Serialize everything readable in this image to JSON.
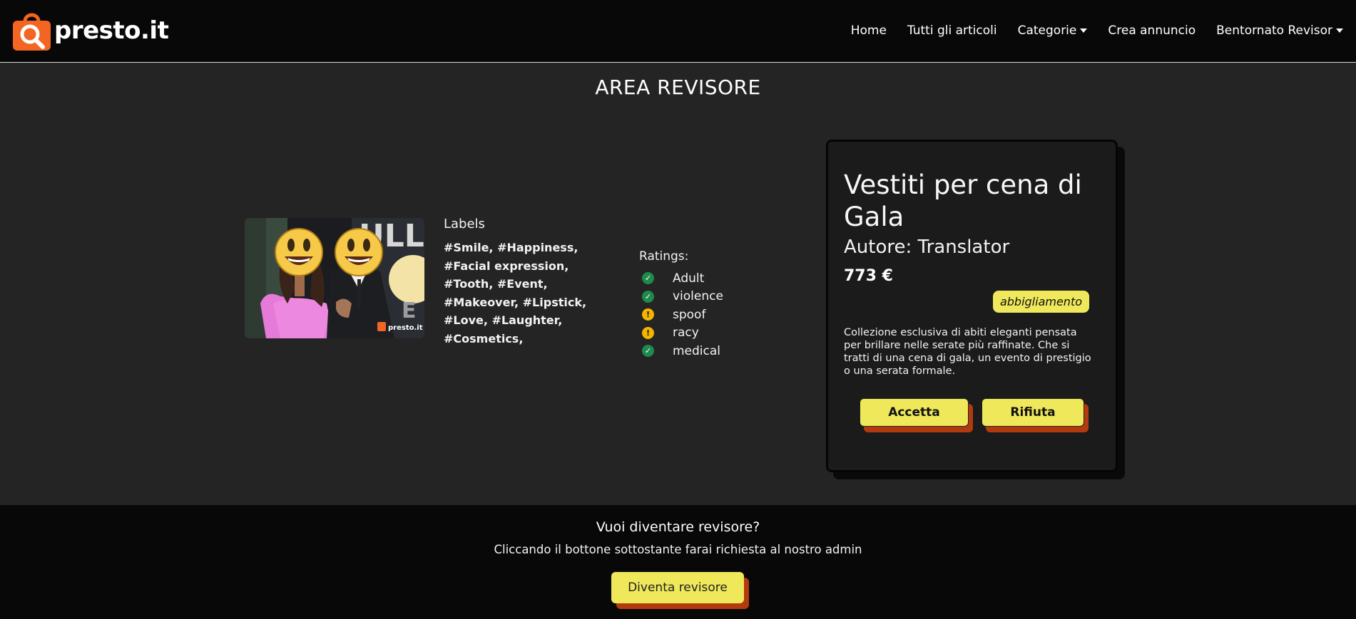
{
  "brand": {
    "name": "presto.it",
    "logo_icon": "shopping-bag-search-icon",
    "accent": "#f26522"
  },
  "nav": {
    "items": [
      {
        "label": "Home"
      },
      {
        "label": "Tutti gli articoli"
      },
      {
        "label": "Categorie",
        "dropdown": true
      },
      {
        "label": "Crea annuncio"
      },
      {
        "label": "Bentornato Revisor",
        "dropdown": true
      }
    ]
  },
  "page": {
    "title": "AREA REVISORE"
  },
  "image": {
    "watermark": "presto.it",
    "face_icon": "smiley-face-icon"
  },
  "labels": {
    "title": "Labels",
    "text": "#Smile, #Happiness, #Facial expression, #Tooth, #Event, #Makeover, #Lipstick, #Love, #Laughter, #Cosmetics,"
  },
  "ratings": {
    "title": "Ratings:",
    "items": [
      {
        "label": "Adult",
        "status": "ok",
        "icon": "check-circle-icon",
        "symbol": "✓"
      },
      {
        "label": "violence",
        "status": "ok",
        "icon": "check-circle-icon",
        "symbol": "✓"
      },
      {
        "label": "spoof",
        "status": "warn",
        "icon": "exclamation-circle-icon",
        "symbol": "!"
      },
      {
        "label": "racy",
        "status": "warn",
        "icon": "exclamation-circle-icon",
        "symbol": "!"
      },
      {
        "label": "medical",
        "status": "ok",
        "icon": "check-circle-icon",
        "symbol": "✓"
      }
    ]
  },
  "article": {
    "title": "Vestiti per cena di Gala",
    "author": "Autore: Translator",
    "price": "773 €",
    "category": "abbigliamento",
    "description": "Collezione esclusiva di abiti eleganti pensata per brillare nelle serate più raffinate. Che si tratti di una cena di gala, un evento di prestigio o una serata formale.",
    "accept_label": "Accetta",
    "reject_label": "Rifiuta"
  },
  "footer": {
    "title": "Vuoi diventare revisore?",
    "subtitle": "Cliccando il bottone sottostante farai richiesta al nostro admin",
    "button_label": "Diventa revisore"
  },
  "colors": {
    "background": "#242424",
    "navbar": "#080808",
    "button_yellow": "#eee85a",
    "button_shadow": "#b33a0e",
    "ok_green": "#1e8a4c",
    "warn_yellow": "#f5b400"
  }
}
